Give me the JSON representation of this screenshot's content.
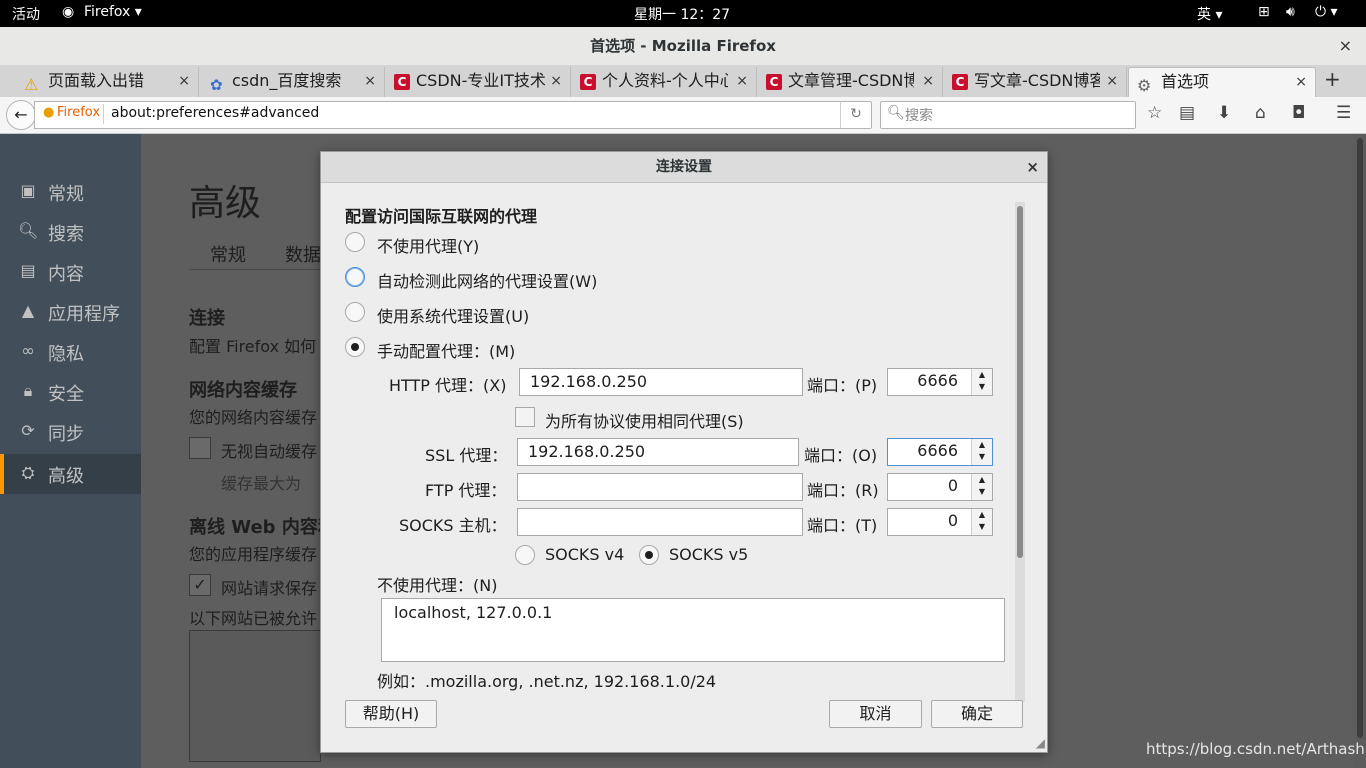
{
  "topbar": {
    "activities": "活动",
    "app": "Firefox ▾",
    "clock": "星期一 12：27",
    "input_method": "英 ▾",
    "status_icons": [
      "network-icon",
      "volume-icon",
      "power-icon"
    ]
  },
  "window": {
    "title": "首选项 - Mozilla Firefox",
    "close": "×"
  },
  "tabs": [
    {
      "label": "页面载入出错",
      "icon": "warning-icon",
      "close": "×"
    },
    {
      "label": "csdn_百度搜索",
      "icon": "baidu-paw-icon",
      "close": "×"
    },
    {
      "label": "CSDN-专业IT技术社",
      "icon": "csdn-icon",
      "close": "×"
    },
    {
      "label": "个人资料-个人中心",
      "icon": "csdn-icon",
      "close": "×"
    },
    {
      "label": "文章管理-CSDN博客",
      "icon": "csdn-icon",
      "close": "×"
    },
    {
      "label": "写文章-CSDN博客",
      "icon": "csdn-icon",
      "close": "×"
    },
    {
      "label": "首选项",
      "icon": "gear-icon",
      "close": "×",
      "active": true
    }
  ],
  "new_tab": "+",
  "navbar": {
    "identity": "Firefox",
    "url": "about:preferences#advanced",
    "search_placeholder": "搜索"
  },
  "sidebar": {
    "items": [
      {
        "label": "常规",
        "icon": "general-icon"
      },
      {
        "label": "搜索",
        "icon": "search-icon"
      },
      {
        "label": "内容",
        "icon": "content-icon"
      },
      {
        "label": "应用程序",
        "icon": "applications-icon"
      },
      {
        "label": "隐私",
        "icon": "privacy-mask-icon"
      },
      {
        "label": "安全",
        "icon": "security-lock-icon"
      },
      {
        "label": "同步",
        "icon": "sync-icon"
      },
      {
        "label": "高级",
        "icon": "advanced-wizard-icon",
        "active": true
      }
    ]
  },
  "page": {
    "heading": "高级",
    "subtab_general": "常规",
    "subtab_data": "数据",
    "connection_heading": "连接",
    "connection_desc": "配置 Firefox 如何",
    "cache_heading": "网络内容缓存",
    "cache_desc": "您的网络内容缓存",
    "cache_override": "无视自动缓存",
    "cache_limit": "缓存最大为",
    "offline_heading": "离线 Web 内容和",
    "offline_desc": "您的应用程序缓存",
    "offline_tell": "网站请求保存",
    "offline_allowed": "以下网站已被允许"
  },
  "dialog": {
    "title": "连接设置",
    "close": "×",
    "section_title": "配置访问国际互联网的代理",
    "opt_no_proxy": "不使用代理(Y)",
    "opt_auto_detect": "自动检测此网络的代理设置(W)",
    "opt_system": "使用系统代理设置(U)",
    "opt_manual": "手动配置代理：(M)",
    "http_label": "HTTP 代理：(X)",
    "http_value": "192.168.0.250",
    "http_port_label": "端口：(P)",
    "http_port": "6666",
    "same_proxy": "为所有协议使用相同代理(S)",
    "ssl_label": "SSL 代理：",
    "ssl_value": "192.168.0.250",
    "ssl_port_label": "端口：(O)",
    "ssl_port": "6666",
    "ftp_label": "FTP 代理：",
    "ftp_value": "",
    "ftp_port_label": "端口：(R)",
    "ftp_port": "0",
    "socks_label": "SOCKS 主机：",
    "socks_value": "",
    "socks_port_label": "端口：(T)",
    "socks_port": "0",
    "socks_v4": "SOCKS v4",
    "socks_v5": "SOCKS v5",
    "no_proxy_label": "不使用代理：(N)",
    "no_proxy_value": "localhost, 127.0.0.1",
    "example": "例如：.mozilla.org, .net.nz, 192.168.1.0/24",
    "help": "帮助(H)",
    "cancel": "取消",
    "ok": "确定"
  },
  "watermark": "https://blog.csdn.net/Arthashit"
}
